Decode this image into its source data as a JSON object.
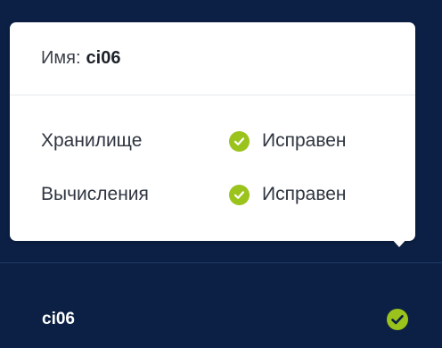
{
  "tooltip": {
    "name_label": "Имя:",
    "name_value": "ci06",
    "rows": [
      {
        "label": "Хранилище",
        "status": "Исправен",
        "status_color": "#9ac31b"
      },
      {
        "label": "Вычисления",
        "status": "Исправен",
        "status_color": "#9ac31b"
      }
    ]
  },
  "node": {
    "name": "ci06",
    "status_icon": "check-circle-icon",
    "status_color": "#9ac31b"
  },
  "colors": {
    "background": "#0c2045",
    "tooltip_background": "#ffffff",
    "healthy": "#9ac31b"
  }
}
